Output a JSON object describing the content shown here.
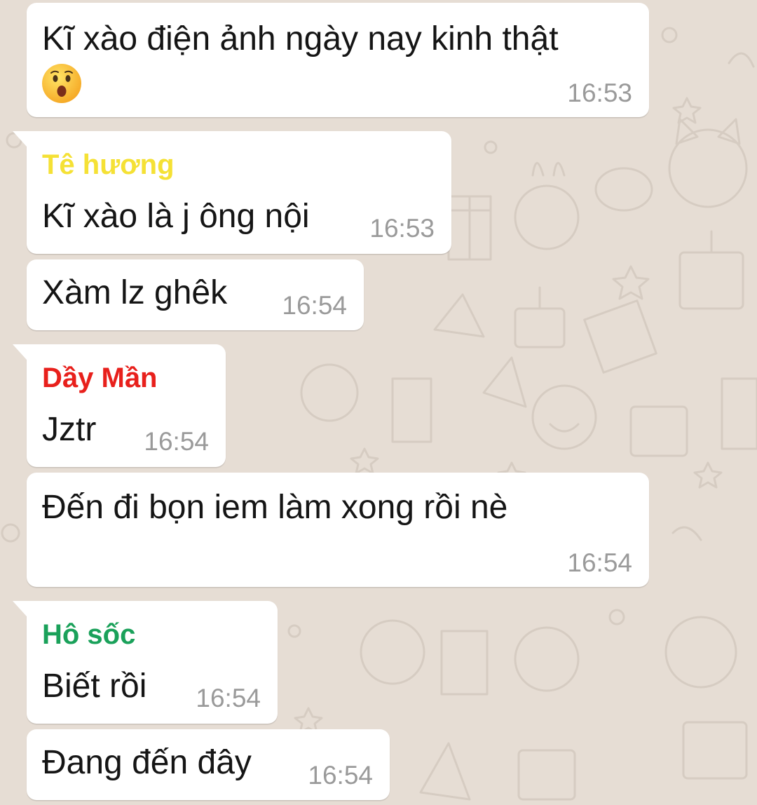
{
  "messages": [
    {
      "text": "Kĩ xào điện ảnh ngày nay kinh thật",
      "time": "16:53",
      "emoji": "astonished-face"
    },
    {
      "sender": "Tê hương",
      "sender_color": "#f5e135",
      "text": "Kĩ xào là j ông nội",
      "time": "16:53"
    },
    {
      "text": "Xàm lz ghêk",
      "time": "16:54"
    },
    {
      "sender": "Dầy Mần",
      "sender_color": "#e8201c",
      "text": "Jztr",
      "time": "16:54"
    },
    {
      "text": "Đến đi bọn iem làm xong rồi nè",
      "time": "16:54"
    },
    {
      "sender": "Hô sốc",
      "sender_color": "#1aa15a",
      "text": "Biết rồi",
      "time": "16:54"
    },
    {
      "text": "Đang đến đây",
      "time": "16:54"
    }
  ]
}
